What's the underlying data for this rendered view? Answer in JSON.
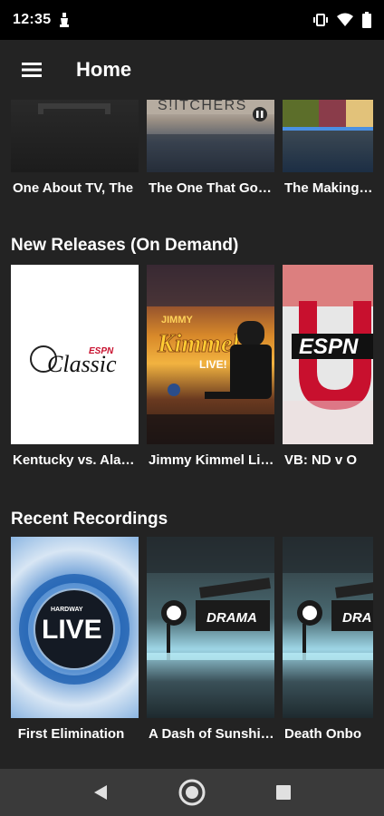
{
  "status": {
    "time": "12:35"
  },
  "app_bar": {
    "title": "Home"
  },
  "rows": [
    {
      "title": "",
      "items": [
        {
          "title": "One About TV, The",
          "thumb_text": ""
        },
        {
          "title": "The One That Go…",
          "thumb_text": "S!ITCHERS"
        },
        {
          "title": "The Making of",
          "thumb_text": ""
        }
      ]
    },
    {
      "title": "New Releases (On Demand)",
      "items": [
        {
          "title": "Kentucky vs. Ala…",
          "thumb_text": "Classic",
          "thumb_brand": "ESPN"
        },
        {
          "title": "Jimmy Kimmel Li…",
          "thumb_text": "Kimmel",
          "thumb_brand": "JIMMY",
          "thumb_sub": "LIVE!"
        },
        {
          "title": "VB: ND v O",
          "thumb_text": "ESPN",
          "thumb_brand": "U"
        }
      ]
    },
    {
      "title": "Recent Recordings",
      "items": [
        {
          "title": "First Elimination",
          "thumb_text": "LIVE",
          "thumb_brand": "HARDWAY"
        },
        {
          "title": "A Dash of Sunshi…",
          "thumb_text": "DRAMA"
        },
        {
          "title": "Death Onbo",
          "thumb_text": "DRA"
        }
      ]
    }
  ],
  "icons": {
    "menu": "hamburger-icon",
    "back": "back-triangle-icon",
    "home": "home-circle-icon",
    "recents": "recents-square-icon"
  }
}
